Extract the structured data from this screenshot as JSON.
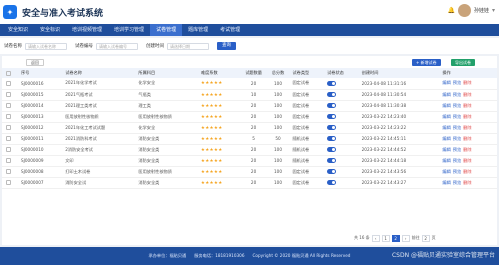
{
  "header": {
    "logo_glyph": "✦",
    "title": "安全与准入考试系统",
    "user_name": "孙娃娃"
  },
  "nav": {
    "items": [
      "安全知识",
      "安全标识",
      "培训视频管理",
      "培训学习管理",
      "试卷管理",
      "题库管理",
      "考试管理"
    ],
    "active_index": 4
  },
  "filter": {
    "exam_name_label": "试卷名称",
    "exam_name_placeholder": "请输入试卷名称",
    "exam_no_label": "试卷编号",
    "exam_no_placeholder": "请输入试卷编号",
    "date_label": "创建时间",
    "date_placeholder": "请选择日期",
    "query_label": "查询"
  },
  "toolbar": {
    "back_label": "返回",
    "add_label": "+ 新增试卷",
    "export_label": "导出试卷"
  },
  "table": {
    "headers": [
      "序号",
      "试卷名称",
      "所属科目",
      "难度系数",
      "试题数量",
      "总分数",
      "试卷类型",
      "试卷状态",
      "创建时间",
      "操作"
    ],
    "rows": [
      {
        "no": "SJ0000016",
        "name": "2021年化学考试",
        "subject": "化学安全",
        "stars": "★★★★★",
        "count": "20",
        "score": "100",
        "type": "固定试卷",
        "on": true,
        "time": "2023-04-08 11:31:16"
      },
      {
        "no": "SJ0000015",
        "name": "2021气瓶考试",
        "subject": "气瓶类",
        "stars": "★★★★★",
        "count": "10",
        "score": "100",
        "type": "固定试卷",
        "on": true,
        "time": "2023-04-08 11:30:54"
      },
      {
        "no": "SJ0000014",
        "name": "2021理工类考试",
        "subject": "理工类",
        "stars": "★★★★★",
        "count": "20",
        "score": "100",
        "type": "固定试卷",
        "on": true,
        "time": "2023-04-08 11:30:38"
      },
      {
        "no": "SJ0000013",
        "name": "医用放射性核物质",
        "subject": "医用放射性核物质",
        "stars": "★★★★★",
        "count": "20",
        "score": "100",
        "type": "固定试卷",
        "on": true,
        "time": "2023-03-22 14:23:40"
      },
      {
        "no": "SJ0000012",
        "name": "2021年化工考试试题",
        "subject": "化学安全",
        "stars": "★★★★★",
        "count": "20",
        "score": "100",
        "type": "固定试卷",
        "on": true,
        "time": "2023-03-22 14:23:22"
      },
      {
        "no": "SJ0000011",
        "name": "2021消防科考试",
        "subject": "消防安全类",
        "stars": "★★★★★",
        "count": "5",
        "score": "50",
        "type": "随机试卷",
        "on": true,
        "time": "2023-03-22 14:45:11"
      },
      {
        "no": "SJ0000010",
        "name": "2消防安全考试",
        "subject": "消防安全类",
        "stars": "★★★★★",
        "count": "20",
        "score": "100",
        "type": "随机试卷",
        "on": true,
        "time": "2023-03-22 14:44:52"
      },
      {
        "no": "SJ0000009",
        "name": "文印",
        "subject": "消防安全类",
        "stars": "★★★★★",
        "count": "20",
        "score": "100",
        "type": "随机试卷",
        "on": true,
        "time": "2023-03-22 14:44:18"
      },
      {
        "no": "SJ0000008",
        "name": "打印土木试卷",
        "subject": "医用放射性核物质",
        "stars": "★★★★★",
        "count": "20",
        "score": "100",
        "type": "固定试卷",
        "on": true,
        "time": "2023-03-22 14:43:56"
      },
      {
        "no": "SJ0000007",
        "name": "消防安全试",
        "subject": "消防安全类",
        "stars": "★★★★★",
        "count": "20",
        "score": "100",
        "type": "固定试卷",
        "on": true,
        "time": "2023-03-22 14:43:27"
      }
    ],
    "ops": {
      "edit": "编辑",
      "view": "预览",
      "delete": "删除"
    }
  },
  "pagination": {
    "total": "共 16 条",
    "prev": "‹",
    "pages": [
      "1",
      "2"
    ],
    "active_page": "2",
    "next": "›",
    "jump_label": "前往",
    "page_value": "2",
    "page_unit": "页"
  },
  "footer": {
    "unit": "承办单位：福贴贝通",
    "phone": "服务电话：18181910306",
    "copyright": "Copyright © 2020 福贴贝通 All Rights Reserved"
  },
  "watermark": "CSDN @福贴贝通实验室综合管理平台"
}
